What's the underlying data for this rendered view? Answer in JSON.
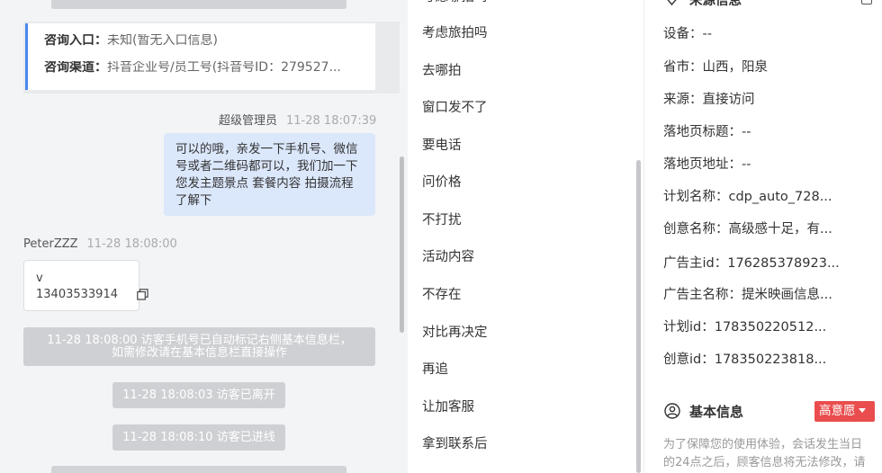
{
  "consult": {
    "entry_label": "咨询入口：",
    "entry_value": "未知(暂无入口信息)",
    "channel_label": "咨询渠道：",
    "channel_value": "抖音企业号/员工号(抖音号ID：279527..."
  },
  "messages": {
    "agent_name": "超级管理员",
    "agent_time": "11-28 18:07:39",
    "agent_text": "可以的哦，亲发一下手机号、微信号或者二维码都可以，我们加一下您发主题景点 套餐内容 拍摄流程了解下",
    "visitor_name": "PeterZZZ",
    "visitor_time": "11-28 18:08:00",
    "visitor_line1": "v",
    "visitor_line2": "13403533914"
  },
  "system": {
    "notice_line1": "11-28 18:08:00 访客手机号已自动标记右侧基本信息栏，",
    "notice_line2": "如需修改请在基本信息栏直接操作",
    "left": "11-28 18:08:03 访客已离开",
    "entered": "11-28 18:08:10 访客已进线"
  },
  "quick_replies": {
    "items": [
      "考虑旅拍吗",
      "去哪拍",
      "窗口发不了",
      "要电话",
      "问价格",
      "不打扰",
      "活动内容",
      "不存在",
      "对比再决定",
      "再追",
      "让加客服",
      "拿到联系后"
    ]
  },
  "source": {
    "rows": [
      {
        "k": "设备：",
        "v": "--"
      },
      {
        "k": "省市：",
        "v": "山西，阳泉"
      },
      {
        "k": "来源：",
        "v": "直接访问"
      },
      {
        "k": "落地页标题：",
        "v": "--"
      },
      {
        "k": "落地页地址：",
        "v": "--"
      },
      {
        "k": "计划名称：",
        "v": "cdp_auto_728..."
      },
      {
        "k": "创意名称：",
        "v": "高级感十足，有..."
      },
      {
        "k": "广告主id：",
        "v": "176285378923..."
      },
      {
        "k": "广告主名称：",
        "v": "提米映画信息..."
      },
      {
        "k": "计划id：",
        "v": "178350220512..."
      },
      {
        "k": "创意id：",
        "v": "178350223818..."
      }
    ]
  },
  "basic": {
    "title": "基本信息",
    "intent": "高意愿",
    "note": "为了保障您的使用体验，会话发生当日的24点之后，顾客信息将无法修改，请"
  },
  "colors": {
    "accent": "#4a88f0",
    "agent_bubble": "#dbe7fb",
    "intent_badge": "#ea4d4d"
  }
}
